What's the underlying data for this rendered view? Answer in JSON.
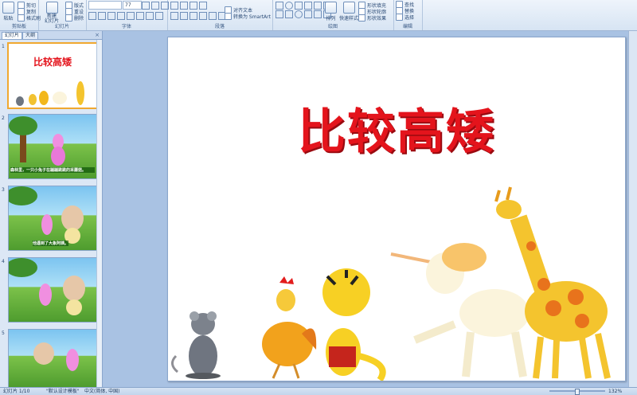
{
  "ribbon": {
    "clipboard": {
      "paste": "粘贴",
      "cut": "剪切",
      "copy": "复制",
      "format_painter": "格式刷",
      "label": "剪贴板"
    },
    "slides": {
      "new_slide": "新建\n幻灯片",
      "layout": "版式",
      "reset": "重设",
      "delete": "删除",
      "label": "幻灯片"
    },
    "font": {
      "size": "77",
      "label": "字体"
    },
    "paragraph": {
      "align_text": "对齐文本",
      "smartart": "转换为 SmartArt",
      "label": "段落"
    },
    "drawing": {
      "arrange": "排列",
      "quick_styles": "快速样式",
      "shape_fill": "形状填充",
      "shape_outline": "形状轮廓",
      "shape_effects": "形状效果",
      "label": "绘图"
    },
    "editing": {
      "find": "查找",
      "replace": "替换",
      "select": "选择",
      "label": "编辑"
    }
  },
  "pane": {
    "tab_slides": "幻灯片",
    "tab_outline": "大纲",
    "close": "×"
  },
  "thumbnails": [
    {
      "number": "1",
      "title": "比较高矮"
    },
    {
      "number": "2",
      "caption": "森林里，一只小兔子在蹦蹦跳跳的采蘑菇。"
    },
    {
      "number": "3",
      "caption": "他遇到了大象阿姨。"
    },
    {
      "number": "4",
      "caption": ""
    },
    {
      "number": "5",
      "caption": ""
    }
  ],
  "slide": {
    "title": "比较高矮"
  },
  "status": {
    "slide_count": "幻灯片 1/10",
    "theme": "\"默认设计模板\"",
    "language": "中文(简体, 中国)",
    "zoom": "132%"
  },
  "colors": {
    "title_red": "#e4141c",
    "selection": "#f0a830",
    "workspace": "#a9c2e3"
  }
}
